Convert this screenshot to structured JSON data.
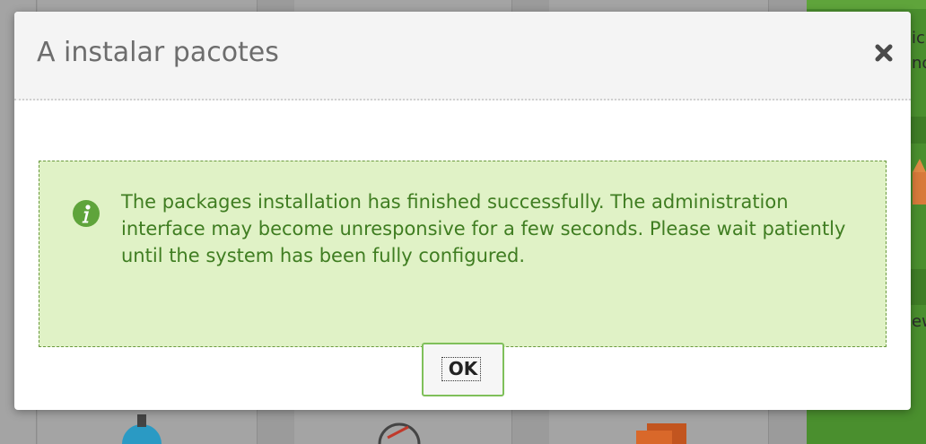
{
  "dialog": {
    "title": "A instalar pacotes",
    "close_icon": "close-icon",
    "message": "The packages installation has finished successfully. The administration interface may become unresponsive for a few seconds. Please wait patiently until the system has been fully configured.",
    "message_icon": "info-icon",
    "ok_label": "OK"
  },
  "background": {
    "partial_text_1": "ic",
    "partial_text_2": "no",
    "partial_text_3": "ew"
  },
  "colors": {
    "accent_green": "#5fa43b",
    "message_bg": "#e0f2c6",
    "message_text": "#3f7d21",
    "title_text": "#6d6d6d"
  }
}
